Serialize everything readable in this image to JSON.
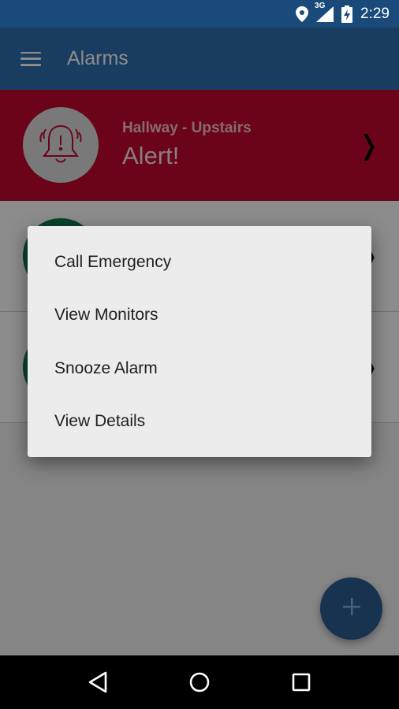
{
  "status_bar": {
    "time": "2:29",
    "network": "3G",
    "icons": [
      "location-icon",
      "cell-signal-icon",
      "battery-charging-icon"
    ]
  },
  "app_bar": {
    "title": "Alarms",
    "menu_icon": "menu-icon"
  },
  "alarms": [
    {
      "location": "Hallway - Upstairs",
      "status": "Alert!",
      "icon": "alarm-bell-icon",
      "color": "#c4082e"
    },
    {
      "location": "",
      "status": "",
      "icon": "",
      "color": "#117a4f"
    },
    {
      "location": "",
      "status": "",
      "icon": "",
      "color": "#117a4f"
    }
  ],
  "dialog": {
    "items": [
      {
        "label": "Call Emergency"
      },
      {
        "label": "View Monitors"
      },
      {
        "label": "Snooze Alarm"
      },
      {
        "label": "View Details"
      }
    ]
  },
  "fab": {
    "icon": "plus-icon",
    "color": "#2c5d93"
  },
  "nav_bar": {
    "icons": [
      "back-icon",
      "home-icon",
      "recents-icon"
    ]
  },
  "colors": {
    "status_bar": "#1a4a7a",
    "app_bar": "#2f6fb0",
    "alert": "#c4082e"
  }
}
